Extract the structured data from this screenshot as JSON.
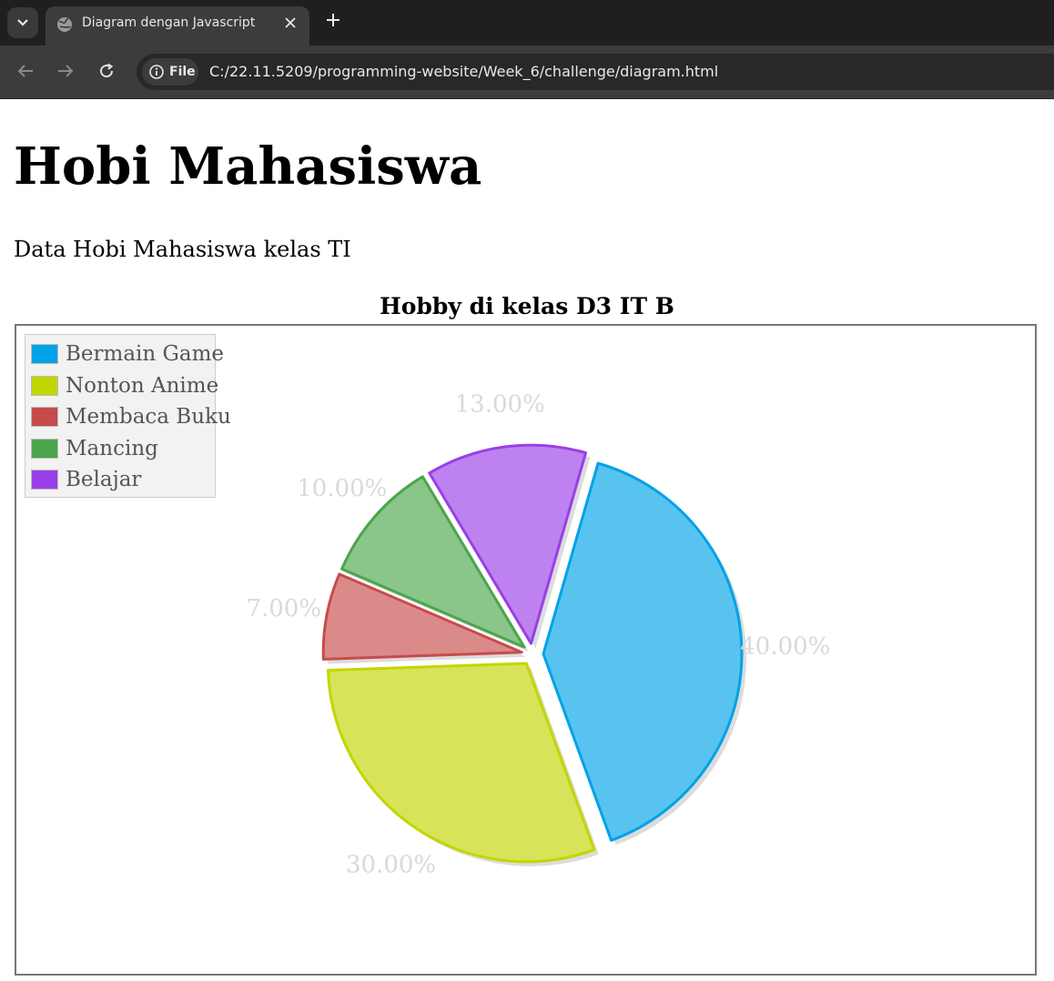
{
  "browser": {
    "tab_title": "Diagram dengan Javascript",
    "info_chip_label": "File",
    "url": "C:/22.11.5209/programming-website/Week_6/challenge/diagram.html",
    "icons": [
      "chevron-down-icon",
      "globe-icon",
      "close-icon",
      "plus-icon",
      "back-arrow-icon",
      "forward-arrow-icon",
      "reload-icon",
      "info-icon"
    ]
  },
  "page": {
    "heading": "Hobi Mahasiswa",
    "description": "Data Hobi Mahasiswa kelas TI"
  },
  "chart_data": {
    "type": "pie",
    "title": "Hobby di kelas D3 IT B",
    "legend_position": "top-left",
    "categories": [
      "Bermain Game",
      "Nonton Anime",
      "Membaca Buku",
      "Mancing",
      "Belajar"
    ],
    "values": [
      40,
      30,
      7,
      10,
      13
    ],
    "labels": [
      "40.00%",
      "30.00%",
      "7.00%",
      "10.00%",
      "13.00%"
    ],
    "colors": [
      "#00a2e8",
      "#c2d600",
      "#c84b4b",
      "#4ba54b",
      "#9a3fe8"
    ],
    "exploded": true
  }
}
